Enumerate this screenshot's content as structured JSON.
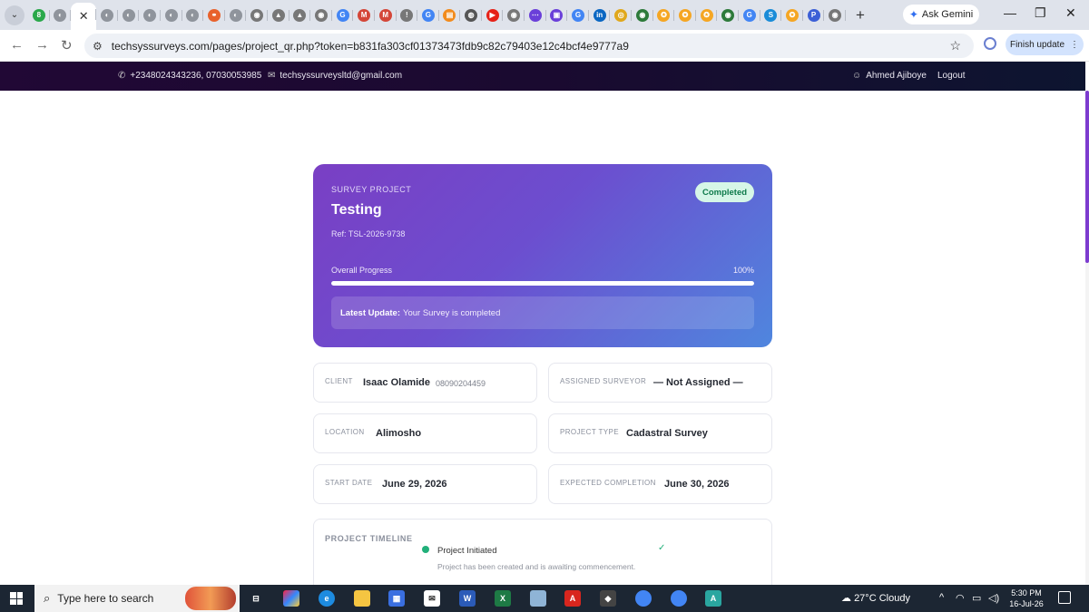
{
  "browser": {
    "active_tab_close": "✕",
    "new_tab": "+",
    "ask_gemini": "Ask Gemini",
    "url": "techsyssurveys.com/pages/project_qr.php?token=b831fa303cf01373473fdb9c82c79403e12c4bcf4e9777a9",
    "finish_update": "Finish update",
    "tab_favicons": [
      {
        "c": "#2aa84a",
        "t": "8"
      },
      {
        "c": "#8f949c",
        "t": "◐"
      },
      {
        "c": "#8f949c",
        "t": "◐"
      },
      {
        "c": "#8f949c",
        "t": "◐"
      },
      {
        "c": "#8f949c",
        "t": "◐"
      },
      {
        "c": "#8f949c",
        "t": "◐"
      },
      {
        "c": "#8f949c",
        "t": "◐"
      },
      {
        "c": "#e8622c",
        "t": "⚭"
      },
      {
        "c": "#8f949c",
        "t": "◐"
      },
      {
        "c": "#777",
        "t": "◉"
      },
      {
        "c": "#777",
        "t": "▲"
      },
      {
        "c": "#777",
        "t": "▲"
      },
      {
        "c": "#777",
        "t": "◉"
      },
      {
        "c": "#4285f4",
        "t": "G"
      },
      {
        "c": "#d44638",
        "t": "M"
      },
      {
        "c": "#d44638",
        "t": "M"
      },
      {
        "c": "#777",
        "t": "!"
      },
      {
        "c": "#4285f4",
        "t": "G"
      },
      {
        "c": "#f28b1c",
        "t": "▤"
      },
      {
        "c": "#555",
        "t": "◍"
      },
      {
        "c": "#e62117",
        "t": "▶"
      },
      {
        "c": "#777",
        "t": "◉"
      },
      {
        "c": "#6a3fd9",
        "t": "⋯"
      },
      {
        "c": "#6a3fd9",
        "t": "▣"
      },
      {
        "c": "#4285f4",
        "t": "G"
      },
      {
        "c": "#0a66c2",
        "t": "in"
      },
      {
        "c": "#e0a81c",
        "t": "◎"
      },
      {
        "c": "#2d7a3a",
        "t": "◉"
      },
      {
        "c": "#f5a623",
        "t": "✪"
      },
      {
        "c": "#f5a623",
        "t": "✪"
      },
      {
        "c": "#f5a623",
        "t": "✪"
      },
      {
        "c": "#2d7a3a",
        "t": "◉"
      },
      {
        "c": "#4285f4",
        "t": "G"
      },
      {
        "c": "#1a8cd8",
        "t": "S"
      },
      {
        "c": "#f5a623",
        "t": "✪"
      },
      {
        "c": "#3b5fd6",
        "t": "P"
      },
      {
        "c": "#777",
        "t": "◉"
      }
    ]
  },
  "site_header": {
    "phone": "+2348024343236, 07030053985",
    "email": "techsyssurveysltd@gmail.com",
    "user": "Ahmed Ajiboye",
    "logout": "Logout"
  },
  "project": {
    "eyebrow": "SURVEY PROJECT",
    "title": "Testing",
    "ref": "Ref: TSL-2026-9738",
    "status": "Completed",
    "progress_label": "Overall Progress",
    "progress_text": "100%",
    "progress_value": 100,
    "latest_update_label": "Latest Update:",
    "latest_update_text": "Your Survey is completed"
  },
  "details": {
    "client_label": "CLIENT",
    "client_name": "Isaac Olamide",
    "client_phone": "08090204459",
    "surveyor_label": "ASSIGNED SURVEYOR",
    "surveyor_value": "— Not Assigned —",
    "location_label": "LOCATION",
    "location_value": "Alimosho",
    "type_label": "PROJECT TYPE",
    "type_value": "Cadastral Survey",
    "start_label": "START DATE",
    "start_value": "June 29, 2026",
    "completion_label": "EXPECTED COMPLETION",
    "completion_value": "June 30, 2026"
  },
  "timeline": {
    "label": "PROJECT TIMELINE",
    "step": "Project Initiated",
    "desc": "Project has been created and is awaiting commencement.",
    "check": "✓"
  },
  "taskbar": {
    "search_placeholder": "Type here to search",
    "weather": "27°C  Cloudy",
    "time": "5:30 PM",
    "date": "16-Jul-26"
  },
  "colors": {
    "accent_purple": "#7a3fc4",
    "accent_blue": "#4f86de",
    "success": "#22b07a",
    "header_bg": "#210835"
  }
}
